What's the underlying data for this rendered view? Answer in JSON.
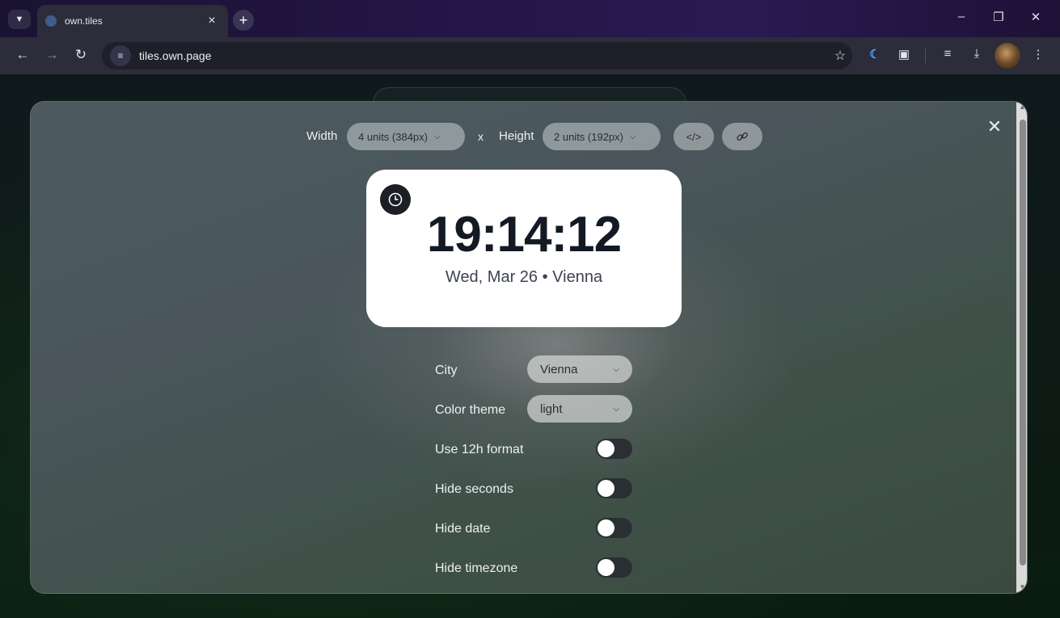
{
  "browser": {
    "tab_title": "own.tiles",
    "url": "tiles.own.page"
  },
  "sizing": {
    "width_label": "Width",
    "width_value": "4 units (384px)",
    "times": "x",
    "height_label": "Height",
    "height_value": "2 units (192px)",
    "embed_icon": "</>"
  },
  "widget": {
    "time": "19:14:12",
    "date": "Wed, Mar 26 • Vienna"
  },
  "settings": {
    "city_label": "City",
    "city_value": "Vienna",
    "theme_label": "Color theme",
    "theme_value": "light",
    "toggles": [
      {
        "label": "Use 12h format",
        "on": false
      },
      {
        "label": "Hide seconds",
        "on": false
      },
      {
        "label": "Hide date",
        "on": false
      },
      {
        "label": "Hide timezone",
        "on": false
      }
    ]
  },
  "icons": {
    "tab_search": "chevron-down-icon",
    "new_tab": "plus-icon",
    "back": "arrow-left-icon",
    "forward": "arrow-right-icon",
    "reload": "reload-icon",
    "site_info": "tune-icon",
    "bookmark": "star-icon",
    "extension_1": "extension-c-icon",
    "extensions": "puzzle-icon",
    "reading_list": "reading-list-icon",
    "downloads": "download-icon",
    "menu": "kebab-menu-icon",
    "embed": "code-icon",
    "link": "link-icon",
    "close": "close-icon",
    "clock": "clock-icon"
  },
  "colors": {
    "widget_bg": "#ffffff",
    "time_text": "#141a24",
    "toggle_off": "#2a2f34"
  }
}
